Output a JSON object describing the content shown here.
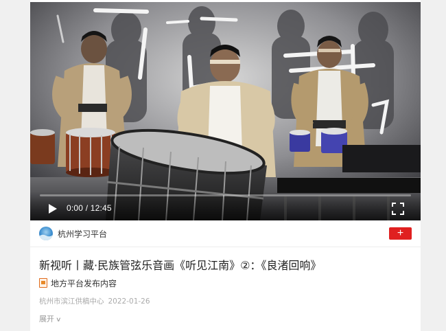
{
  "video": {
    "time_current": "0:00",
    "time_separator": " / ",
    "time_total": "12:45",
    "progress_fraction": 0
  },
  "author": {
    "name": "杭州学习平台",
    "follow_label": "+"
  },
  "article": {
    "title": "新视听丨藏·民族管弦乐音画《听见江南》②：《良渚回响》",
    "source_label": "地方平台发布内容",
    "publisher": "杭州市滨江供稿中心",
    "date": "2022-01-26",
    "expand_label": "展开"
  },
  "colors": {
    "accent_red": "#e02020",
    "source_icon": "#e06a1a"
  },
  "icons": {
    "play": "play-icon",
    "fullscreen": "fullscreen-icon",
    "source": "platform-badge-icon",
    "expand": "chevron-down-icon"
  }
}
